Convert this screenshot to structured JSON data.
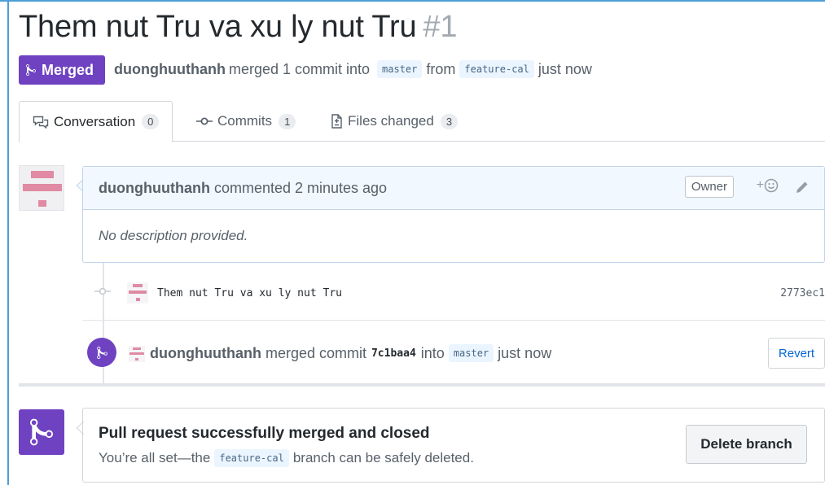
{
  "pr": {
    "title": "Them nut Tru va xu ly nut Tru",
    "number": "#1",
    "state": "Merged",
    "author": "duonghuuthanh",
    "meta_action": "merged 1 commit into",
    "base_branch": "master",
    "from_word": "from",
    "head_branch": "feature-cal",
    "time": "just now"
  },
  "tabs": [
    {
      "label": "Conversation",
      "count": "0"
    },
    {
      "label": "Commits",
      "count": "1"
    },
    {
      "label": "Files changed",
      "count": "3"
    }
  ],
  "comment": {
    "author": "duonghuuthanh",
    "action": "commented 2 minutes ago",
    "role": "Owner",
    "reaction": "+",
    "body": "No description provided."
  },
  "commit": {
    "message": "Them nut Tru va xu ly nut Tru",
    "sha": "2773ec1"
  },
  "merge_event": {
    "author": "duonghuuthanh",
    "action": "merged commit",
    "sha": "7c1baa4",
    "into": "into",
    "branch": "master",
    "time": "just now",
    "revert_label": "Revert"
  },
  "merged_box": {
    "title": "Pull request successfully merged and closed",
    "sub_before": "You’re all set—the",
    "branch": "feature-cal",
    "sub_after": "branch can be safely deleted.",
    "delete_label": "Delete branch"
  },
  "colors": {
    "merged_purple": "#6f42c1",
    "link_blue": "#0366d6",
    "frame_blue": "#4a9fd8",
    "identicon_pink": "#e08aa3"
  }
}
